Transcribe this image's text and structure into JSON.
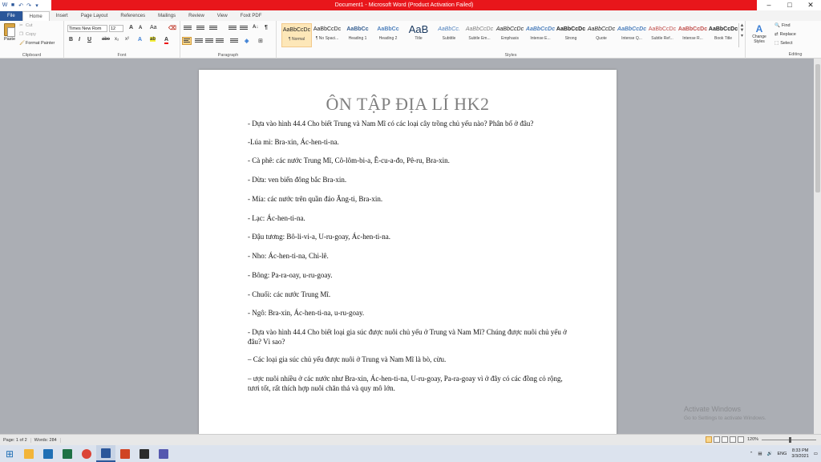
{
  "app": {
    "window_title": "Document1 - Microsoft Word (Product Activation Failed)"
  },
  "qat": {
    "save_icon": "save-icon",
    "undo_icon": "undo-icon",
    "redo_icon": "redo-icon"
  },
  "tabs": [
    {
      "label": "File"
    },
    {
      "label": "Home"
    },
    {
      "label": "Insert"
    },
    {
      "label": "Page Layout"
    },
    {
      "label": "References"
    },
    {
      "label": "Mailings"
    },
    {
      "label": "Review"
    },
    {
      "label": "View"
    },
    {
      "label": "Foxit PDF"
    }
  ],
  "ribbon": {
    "clipboard": {
      "paste": "Paste",
      "cut": "Cut",
      "copy": "Copy",
      "format_painter": "Format Painter",
      "label": "Clipboard"
    },
    "font": {
      "family": "Times New Rom",
      "size": "12",
      "label": "Font",
      "bold": "B",
      "italic": "I",
      "underline": "U",
      "strike": "abe",
      "sub": "x₂",
      "sup": "x²",
      "grow": "A",
      "shrink": "A",
      "case": "Aa",
      "font_color": "A",
      "highlight": "ab"
    },
    "paragraph": {
      "label": "Paragraph"
    },
    "styles": {
      "label": "Styles",
      "items": [
        {
          "preview": "AaBbCcDc",
          "name": "¶ Normal"
        },
        {
          "preview": "AaBbCcDc",
          "name": "¶ No Spaci..."
        },
        {
          "preview": "AaBbCc",
          "name": "Heading 1"
        },
        {
          "preview": "AaBbCc",
          "name": "Heading 2"
        },
        {
          "preview": "AaB",
          "name": "Title"
        },
        {
          "preview": "AaBbCc.",
          "name": "Subtitle"
        },
        {
          "preview": "AaBbCcDc",
          "name": "Subtle Em..."
        },
        {
          "preview": "AaBbCcDc",
          "name": "Emphasis"
        },
        {
          "preview": "AaBbCcDc",
          "name": "Intense E..."
        },
        {
          "preview": "AaBbCcDc",
          "name": "Strong"
        },
        {
          "preview": "AaBbCcDc",
          "name": "Quote"
        },
        {
          "preview": "AaBbCcDc",
          "name": "Intense Q..."
        },
        {
          "preview": "AaBbCcDc",
          "name": "Subtle Ref..."
        },
        {
          "preview": "AaBbCcDc",
          "name": "Intense R..."
        },
        {
          "preview": "AaBbCcDc",
          "name": "Book Title"
        }
      ],
      "change_styles": "Change Styles"
    },
    "editing": {
      "label": "Editing",
      "find": "Find",
      "replace": "Replace",
      "select": "Select"
    }
  },
  "document": {
    "title": "ÔN TẬP ĐỊA LÍ HK2",
    "lines": [
      "- Dựa vào hình 44.4 Cho biết Trung và Nam Mĩ có các loại cây trồng chủ yếu nào? Phân bố ở đâu?",
      "-Lúa mì: Bra-xin, Ác-hen-ti-na.",
      "- Cà phê: các nước Trung Mĩ, Cô-lôm-bi-a, Ê-cu-a-đo, Pê-ru, Bra-xin.",
      " - Dừa: ven biển đông bắc Bra-xin.",
      "- Mía: các nước trên quần đảo Ăng-ti, Bra-xin.",
      "- Lạc: Ác-hen-ti-na.",
      "- Đậu tương: Bô-li-vi-a, U-ru-goay, Ác-hen-ti-na.",
      "- Nho: Ác-hen-ti-na, Chi-lê.",
      "- Bông: Pa-ra-oay, u-ru-goay.",
      "- Chuối: các nước Trung Mĩ.",
      "- Ngô: Bra-xin, Ác-hen-ti-na, u-ru-goay.",
      " - Dựa vào hình 44.4 Cho biết loại gia súc được nuôi chủ yếu ở Trung và Nam Mĩ? Chúng được nuôi chủ yếu ở đâu? Vì sao?",
      "– Các loại gia súc chủ yếu được nuôi ở Trung và Nam Mĩ là bò, cừu.",
      "– ược nuôi nhiều ở các nước như Bra-xin, Ác-hen-ti-na, U-ru-goay, Pa-ra-goay vì ở đây có các đồng cỏ rộng, tươi tốt, rất thích hợp nuôi chăn thả và quy mô lớn."
    ]
  },
  "watermark": {
    "line1": "Activate Windows",
    "line2": "Go to Settings to activate Windows."
  },
  "status": {
    "page": "Page: 1 of 2",
    "words": "Words: 284",
    "zoom": "120%"
  },
  "taskbar": {
    "items": [
      {
        "icon": "file-explorer-icon",
        "color": "#f2b53a"
      },
      {
        "icon": "mail-icon",
        "color": "#1f6fb5"
      },
      {
        "icon": "excel-icon",
        "color": "#1e7145"
      },
      {
        "icon": "chrome-icon",
        "color": "#db4437"
      },
      {
        "icon": "word-icon",
        "color": "#2b579a"
      },
      {
        "icon": "powerpoint-icon",
        "color": "#d04423"
      },
      {
        "icon": "media-icon",
        "color": "#2a2a2a"
      },
      {
        "icon": "teams-icon",
        "color": "#5558af"
      }
    ],
    "lang": "ENG",
    "time": "8:33 PM",
    "date": "3/3/2021"
  }
}
